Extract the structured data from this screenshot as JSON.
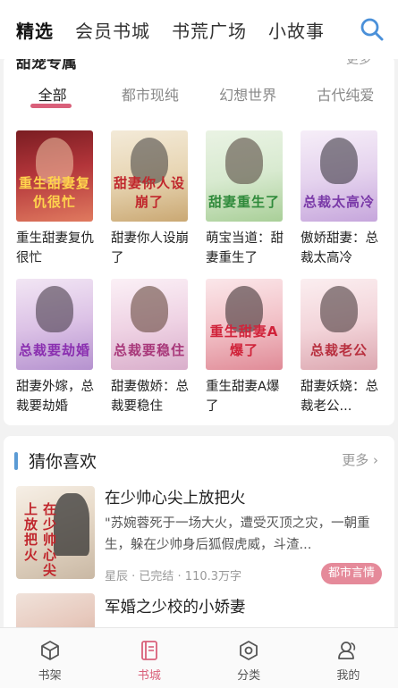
{
  "header": {
    "tabs": [
      {
        "label": "精选",
        "active": true
      },
      {
        "label": "会员书城",
        "active": false
      },
      {
        "label": "书荒广场",
        "active": false
      },
      {
        "label": "小故事",
        "active": false
      }
    ],
    "search_icon": "search-icon"
  },
  "section_one": {
    "title_partial": "甜宠专属",
    "more_partial": "更多",
    "categories": [
      {
        "label": "全部",
        "active": true
      },
      {
        "label": "都市现纯",
        "active": false
      },
      {
        "label": "幻想世界",
        "active": false
      },
      {
        "label": "古代纯爱",
        "active": false
      }
    ],
    "books": [
      {
        "title": "重生甜妻复仇很忙",
        "cover_text": "重生甜妻复仇很忙"
      },
      {
        "title": "甜妻你人设崩了",
        "cover_text": "甜妻你人设崩了"
      },
      {
        "title": "萌宝当道：甜妻重生了",
        "cover_text": "甜妻重生了"
      },
      {
        "title": "傲娇甜妻：总裁太高冷",
        "cover_text": "总裁太高冷"
      },
      {
        "title": "甜妻外嫁，总裁要劫婚",
        "cover_text": "总裁要劫婚"
      },
      {
        "title": "甜妻傲娇：总裁要稳住",
        "cover_text": "总裁要稳住"
      },
      {
        "title": "重生甜妻A爆了",
        "cover_text": "重生甜妻A爆了"
      },
      {
        "title": "甜妻妖娆：总裁老公...",
        "cover_text": "总裁老公"
      }
    ]
  },
  "section_two": {
    "title": "猜你喜欢",
    "more": "更多 ›",
    "items": [
      {
        "title": "在少帅心尖上放把火",
        "description": "\"苏婉蓉死于一场大火，遭受灭顶之灾，一朝重生，躲在少帅身后狐假虎威，斗渣...",
        "meta": "星辰 · 已完结 · 110.3万字",
        "tag": "都市言情",
        "cover_text": "在少帅心尖上放把火"
      },
      {
        "title": "军婚之少校的小娇妻"
      }
    ]
  },
  "bottom_nav": [
    {
      "label": "书架",
      "icon": "cube-icon",
      "active": false
    },
    {
      "label": "书城",
      "icon": "book-icon",
      "active": true
    },
    {
      "label": "分类",
      "icon": "hexagon-icon",
      "active": false
    },
    {
      "label": "我的",
      "icon": "user-icon",
      "active": false
    }
  ],
  "colors": {
    "accent": "#d9607a",
    "section_bar": "#5b9bd5",
    "tag_bg": "#e58a9a"
  }
}
